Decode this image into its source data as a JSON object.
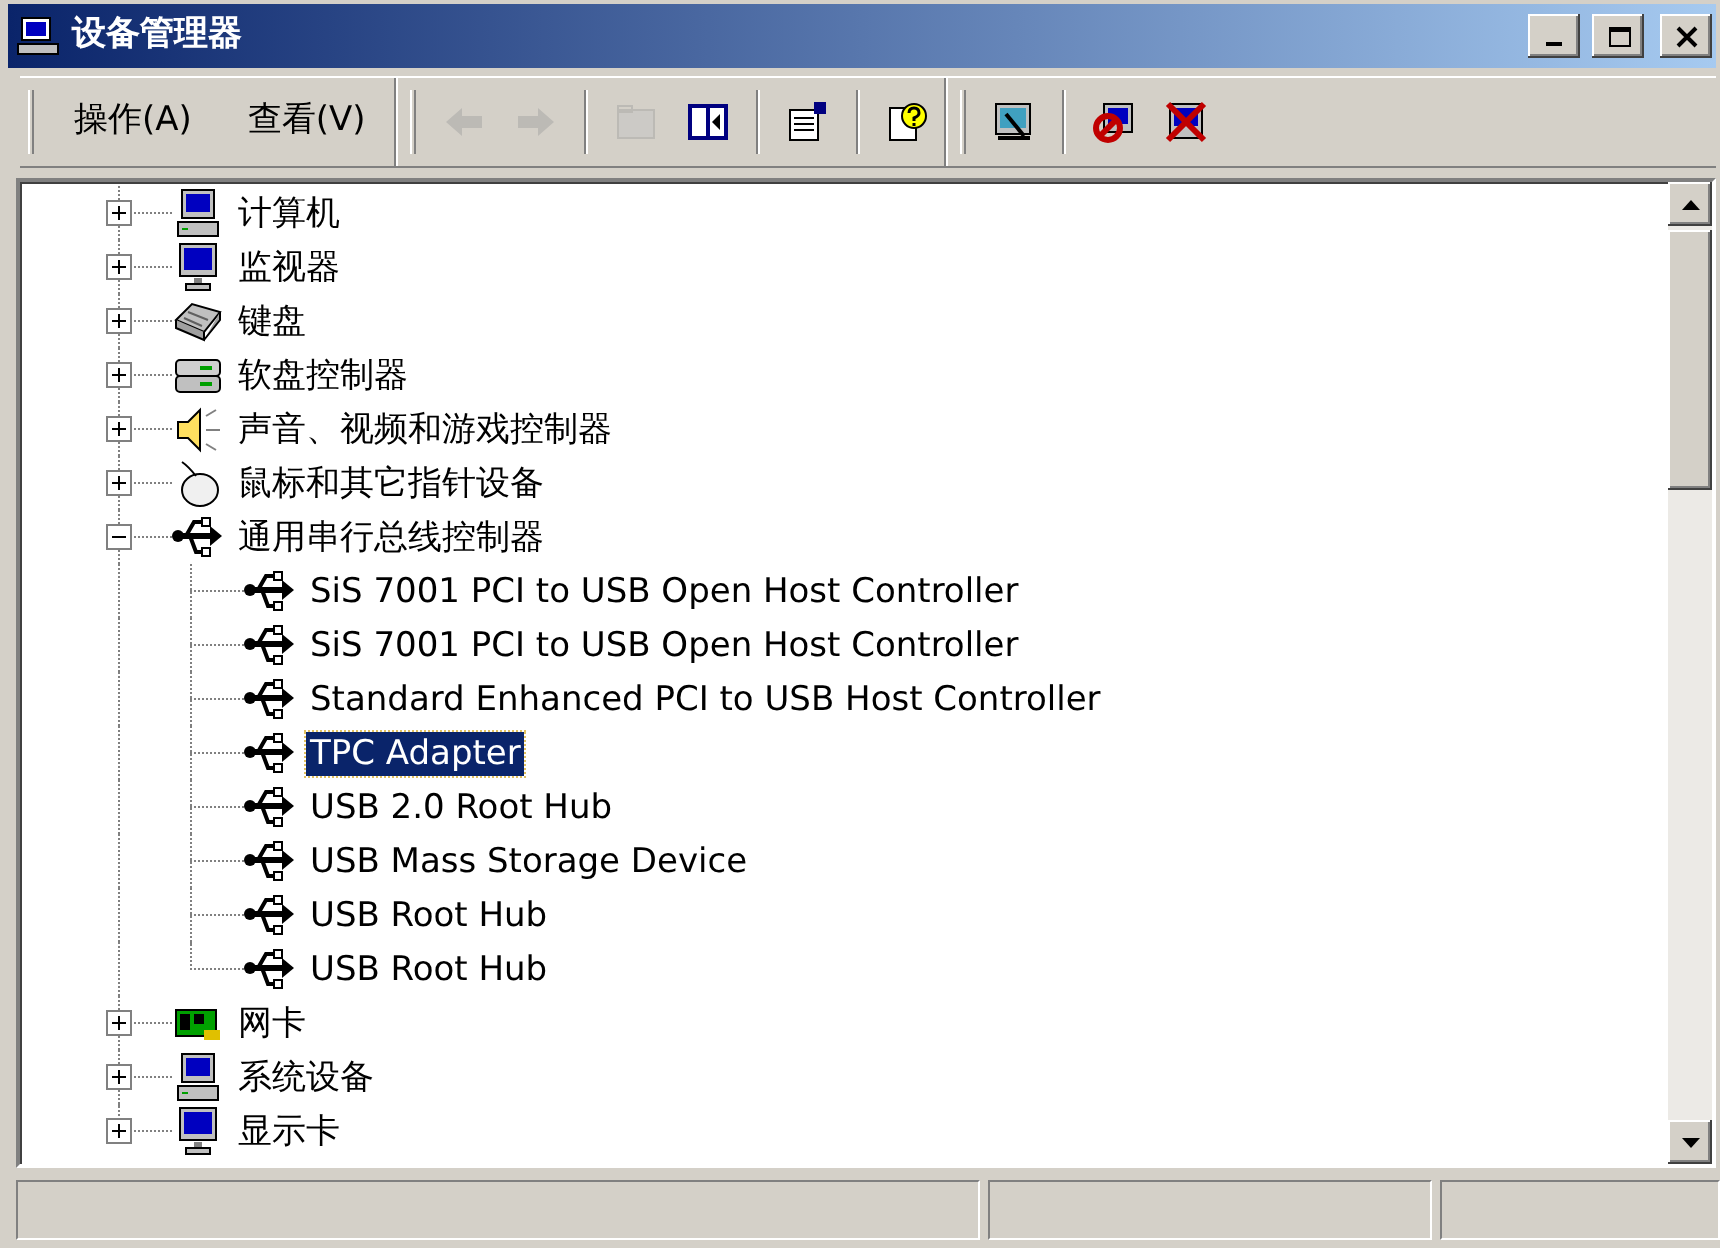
{
  "window": {
    "title": "设备管理器",
    "controls": [
      {
        "kind": "minimize"
      },
      {
        "kind": "maximize"
      },
      {
        "kind": "close"
      }
    ]
  },
  "toolbar": {
    "bands": [
      {
        "groups": [
          [
            {
              "kind": "menu",
              "label": "操作(A)"
            },
            {
              "kind": "menu",
              "label": "查看(V)"
            }
          ]
        ]
      },
      {
        "groups": [
          [
            {
              "kind": "back",
              "disabled": true
            },
            {
              "kind": "forward",
              "disabled": true
            }
          ],
          [
            {
              "kind": "up",
              "disabled": true
            },
            {
              "kind": "tree",
              "disabled": false
            }
          ],
          [
            {
              "kind": "properties",
              "disabled": false
            }
          ],
          [
            {
              "kind": "help",
              "disabled": false
            }
          ]
        ]
      },
      {
        "groups": [
          [
            {
              "kind": "scan",
              "disabled": false
            }
          ],
          [
            {
              "kind": "disable",
              "disabled": false
            },
            {
              "kind": "uninstall",
              "disabled": false
            }
          ]
        ]
      }
    ]
  },
  "tree": [
    {
      "label": "计算机",
      "kind": "computer",
      "expanded": false,
      "selected": false
    },
    {
      "label": "监视器",
      "kind": "monitor",
      "expanded": false,
      "selected": false
    },
    {
      "label": "键盘",
      "kind": "keyboard",
      "expanded": false,
      "selected": false
    },
    {
      "label": "软盘控制器",
      "kind": "floppy",
      "expanded": false,
      "selected": false
    },
    {
      "label": "声音、视频和游戏控制器",
      "kind": "sound",
      "expanded": false,
      "selected": false
    },
    {
      "label": "鼠标和其它指针设备",
      "kind": "mouse",
      "expanded": false,
      "selected": false
    },
    {
      "label": "通用串行总线控制器",
      "kind": "usb",
      "expanded": true,
      "selected": false,
      "children": [
        {
          "label": "SiS 7001 PCI to USB Open Host Controller",
          "kind": "usb",
          "selected": false
        },
        {
          "label": "SiS 7001 PCI to USB Open Host Controller",
          "kind": "usb",
          "selected": false
        },
        {
          "label": "Standard Enhanced PCI to USB Host Controller",
          "kind": "usb",
          "selected": false
        },
        {
          "label": "TPC Adapter",
          "kind": "usb",
          "selected": true
        },
        {
          "label": "USB 2.0 Root Hub",
          "kind": "usb",
          "selected": false
        },
        {
          "label": "USB Mass Storage Device",
          "kind": "usb",
          "selected": false
        },
        {
          "label": "USB Root Hub",
          "kind": "usb",
          "selected": false
        },
        {
          "label": "USB Root Hub",
          "kind": "usb",
          "selected": false
        }
      ]
    },
    {
      "label": "网卡",
      "kind": "network",
      "expanded": false,
      "selected": false
    },
    {
      "label": "系统设备",
      "kind": "computer",
      "expanded": false,
      "selected": false
    },
    {
      "label": "显示卡",
      "kind": "monitor",
      "expanded": false,
      "selected": false
    }
  ]
}
